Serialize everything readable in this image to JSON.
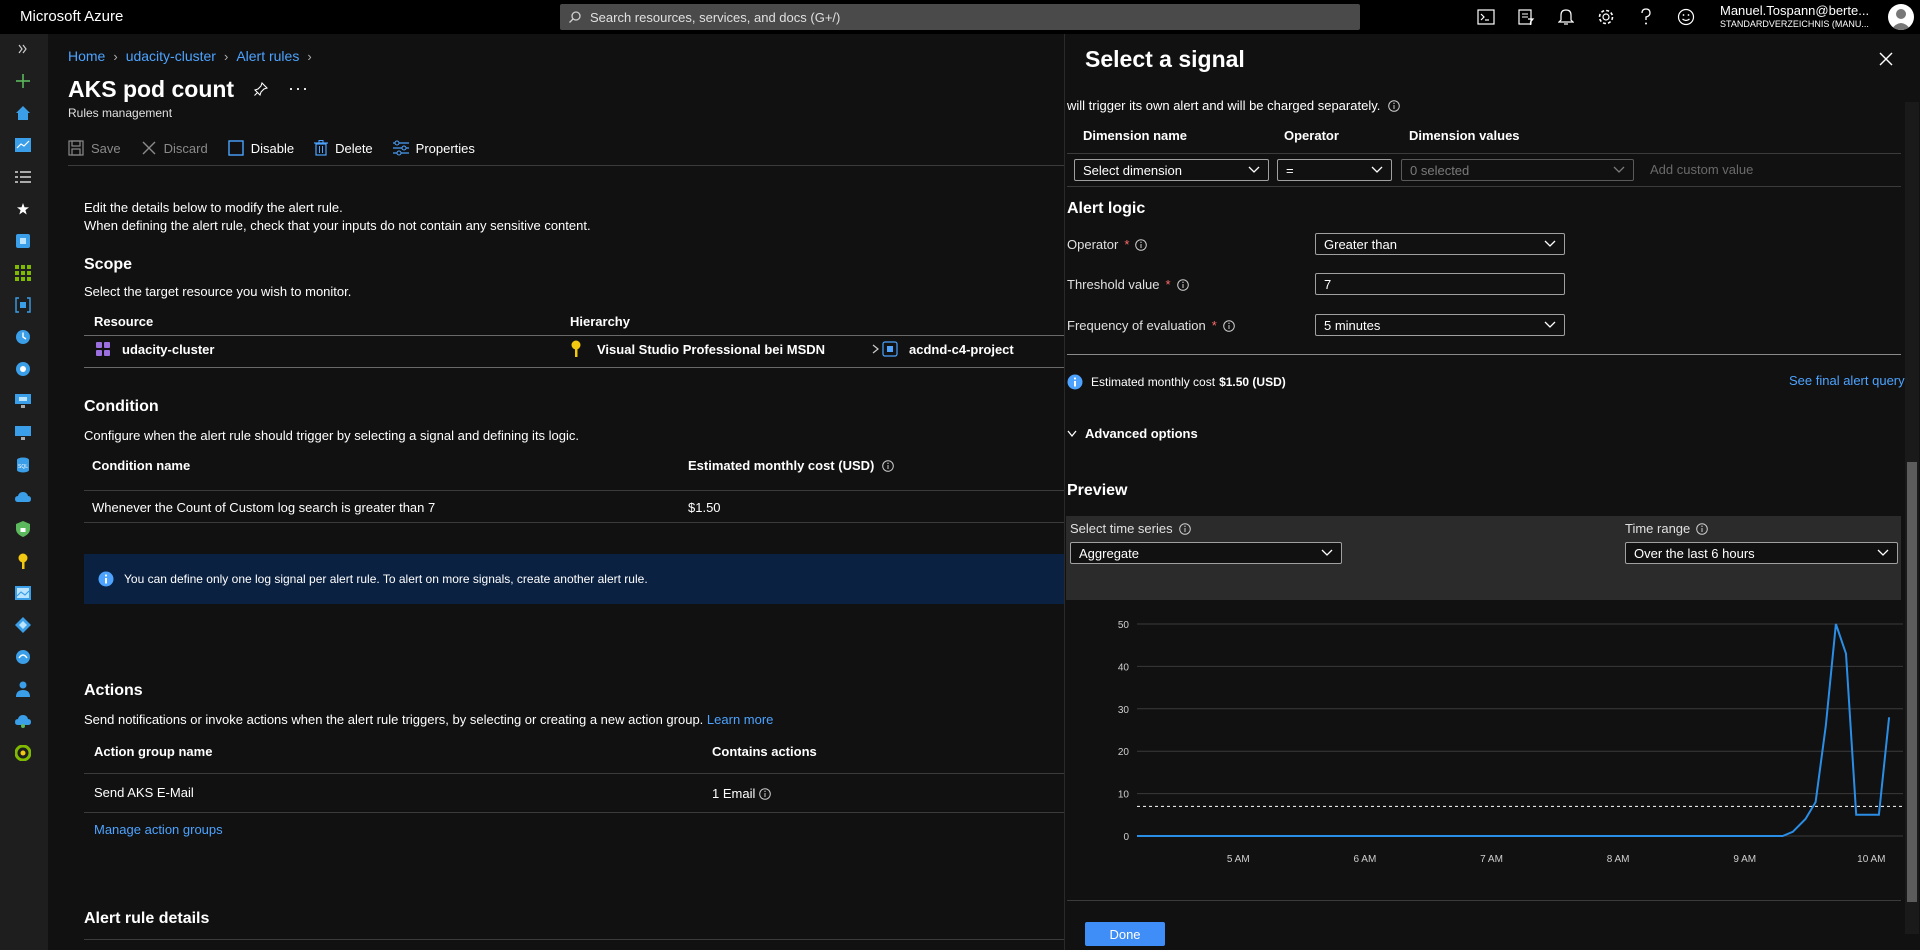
{
  "topbar": {
    "brand": "Microsoft Azure",
    "search_placeholder": "Search resources, services, and docs (G+/)",
    "account_name": "Manuel.Tospann@berte...",
    "account_directory": "STANDARDVERZEICHNIS (MANU..."
  },
  "breadcrumb": {
    "home": "Home",
    "cluster": "udacity-cluster",
    "alert_rules": "Alert rules"
  },
  "page": {
    "title": "AKS pod count",
    "more": "···",
    "subtitle": "Rules management"
  },
  "toolbar": {
    "save": "Save",
    "discard": "Discard",
    "disable": "Disable",
    "delete": "Delete",
    "properties": "Properties"
  },
  "intro": {
    "line1": "Edit the details below to modify the alert rule.",
    "line2": "When defining the alert rule, check that your inputs do not contain any sensitive content."
  },
  "scope": {
    "heading": "Scope",
    "description": "Select the target resource you wish to monitor.",
    "col_resource": "Resource",
    "col_hierarchy": "Hierarchy",
    "resource": "udacity-cluster",
    "subscription": "Visual Studio Professional bei MSDN",
    "resource_group": "acdnd-c4-project"
  },
  "condition": {
    "heading": "Condition",
    "description": "Configure when the alert rule should trigger by selecting a signal and defining its logic.",
    "col_name": "Condition name",
    "col_cost": "Estimated monthly cost (USD)",
    "name": "Whenever the Count of Custom log search is greater than 7",
    "cost": "$1.50",
    "info": "You can define only one log signal per alert rule. To alert on more signals, create another alert rule."
  },
  "actions": {
    "heading": "Actions",
    "description": "Send notifications or invoke actions when the alert rule triggers, by selecting or creating a new action group.",
    "learn_more": "Learn more",
    "col_group": "Action group name",
    "col_contains": "Contains actions",
    "group_name": "Send AKS E-Mail",
    "contains": "1 Email",
    "manage": "Manage action groups"
  },
  "details": {
    "heading": "Alert rule details"
  },
  "panel": {
    "title": "Select a signal",
    "note": "will trigger its own alert and will be charged separately.",
    "dim_col_name": "Dimension name",
    "dim_col_operator": "Operator",
    "dim_col_values": "Dimension values",
    "dim_select": "Select dimension",
    "dim_operator": "=",
    "dim_values": "0 selected",
    "dim_custom": "Add custom value",
    "logic_heading": "Alert logic",
    "operator_label": "Operator",
    "operator_value": "Greater than",
    "threshold_label": "Threshold value",
    "threshold_value": "7",
    "frequency_label": "Frequency of evaluation",
    "frequency_value": "5 minutes",
    "required_mark": "*",
    "cost_prefix": "Estimated monthly cost",
    "cost_value": "$1.50 (USD)",
    "final_query": "See final alert query",
    "advanced": "Advanced options",
    "preview_heading": "Preview",
    "series_label": "Select time series",
    "series_value": "Aggregate",
    "range_label": "Time range",
    "range_value": "Over the last 6 hours",
    "done": "Done"
  },
  "colors": {
    "accent": "#3f8ef7",
    "link": "#4da3ff",
    "series": "#2b8ee6",
    "info_bg": "#0a2141"
  },
  "chart_data": {
    "type": "line",
    "title": "",
    "xlabel": "",
    "ylabel": "",
    "ylim": [
      0,
      50
    ],
    "yticks": [
      "0",
      "10",
      "20",
      "30",
      "40",
      "50"
    ],
    "xlim": [
      4.2,
      10.25
    ],
    "xticks": [
      {
        "x": 5,
        "label": "5 AM"
      },
      {
        "x": 6,
        "label": "6 AM"
      },
      {
        "x": 7,
        "label": "7 AM"
      },
      {
        "x": 8,
        "label": "8 AM"
      },
      {
        "x": 9,
        "label": "9 AM"
      },
      {
        "x": 10,
        "label": "10 AM"
      }
    ],
    "threshold": 7,
    "series": [
      {
        "points": [
          [
            4.2,
            0
          ],
          [
            9.3,
            0
          ],
          [
            9.38,
            1
          ],
          [
            9.48,
            4
          ],
          [
            9.56,
            8
          ],
          [
            9.64,
            26
          ],
          [
            9.72,
            50
          ],
          [
            9.8,
            43
          ],
          [
            9.88,
            5
          ],
          [
            9.96,
            5
          ],
          [
            10.06,
            5
          ],
          [
            10.14,
            28
          ]
        ]
      }
    ]
  }
}
